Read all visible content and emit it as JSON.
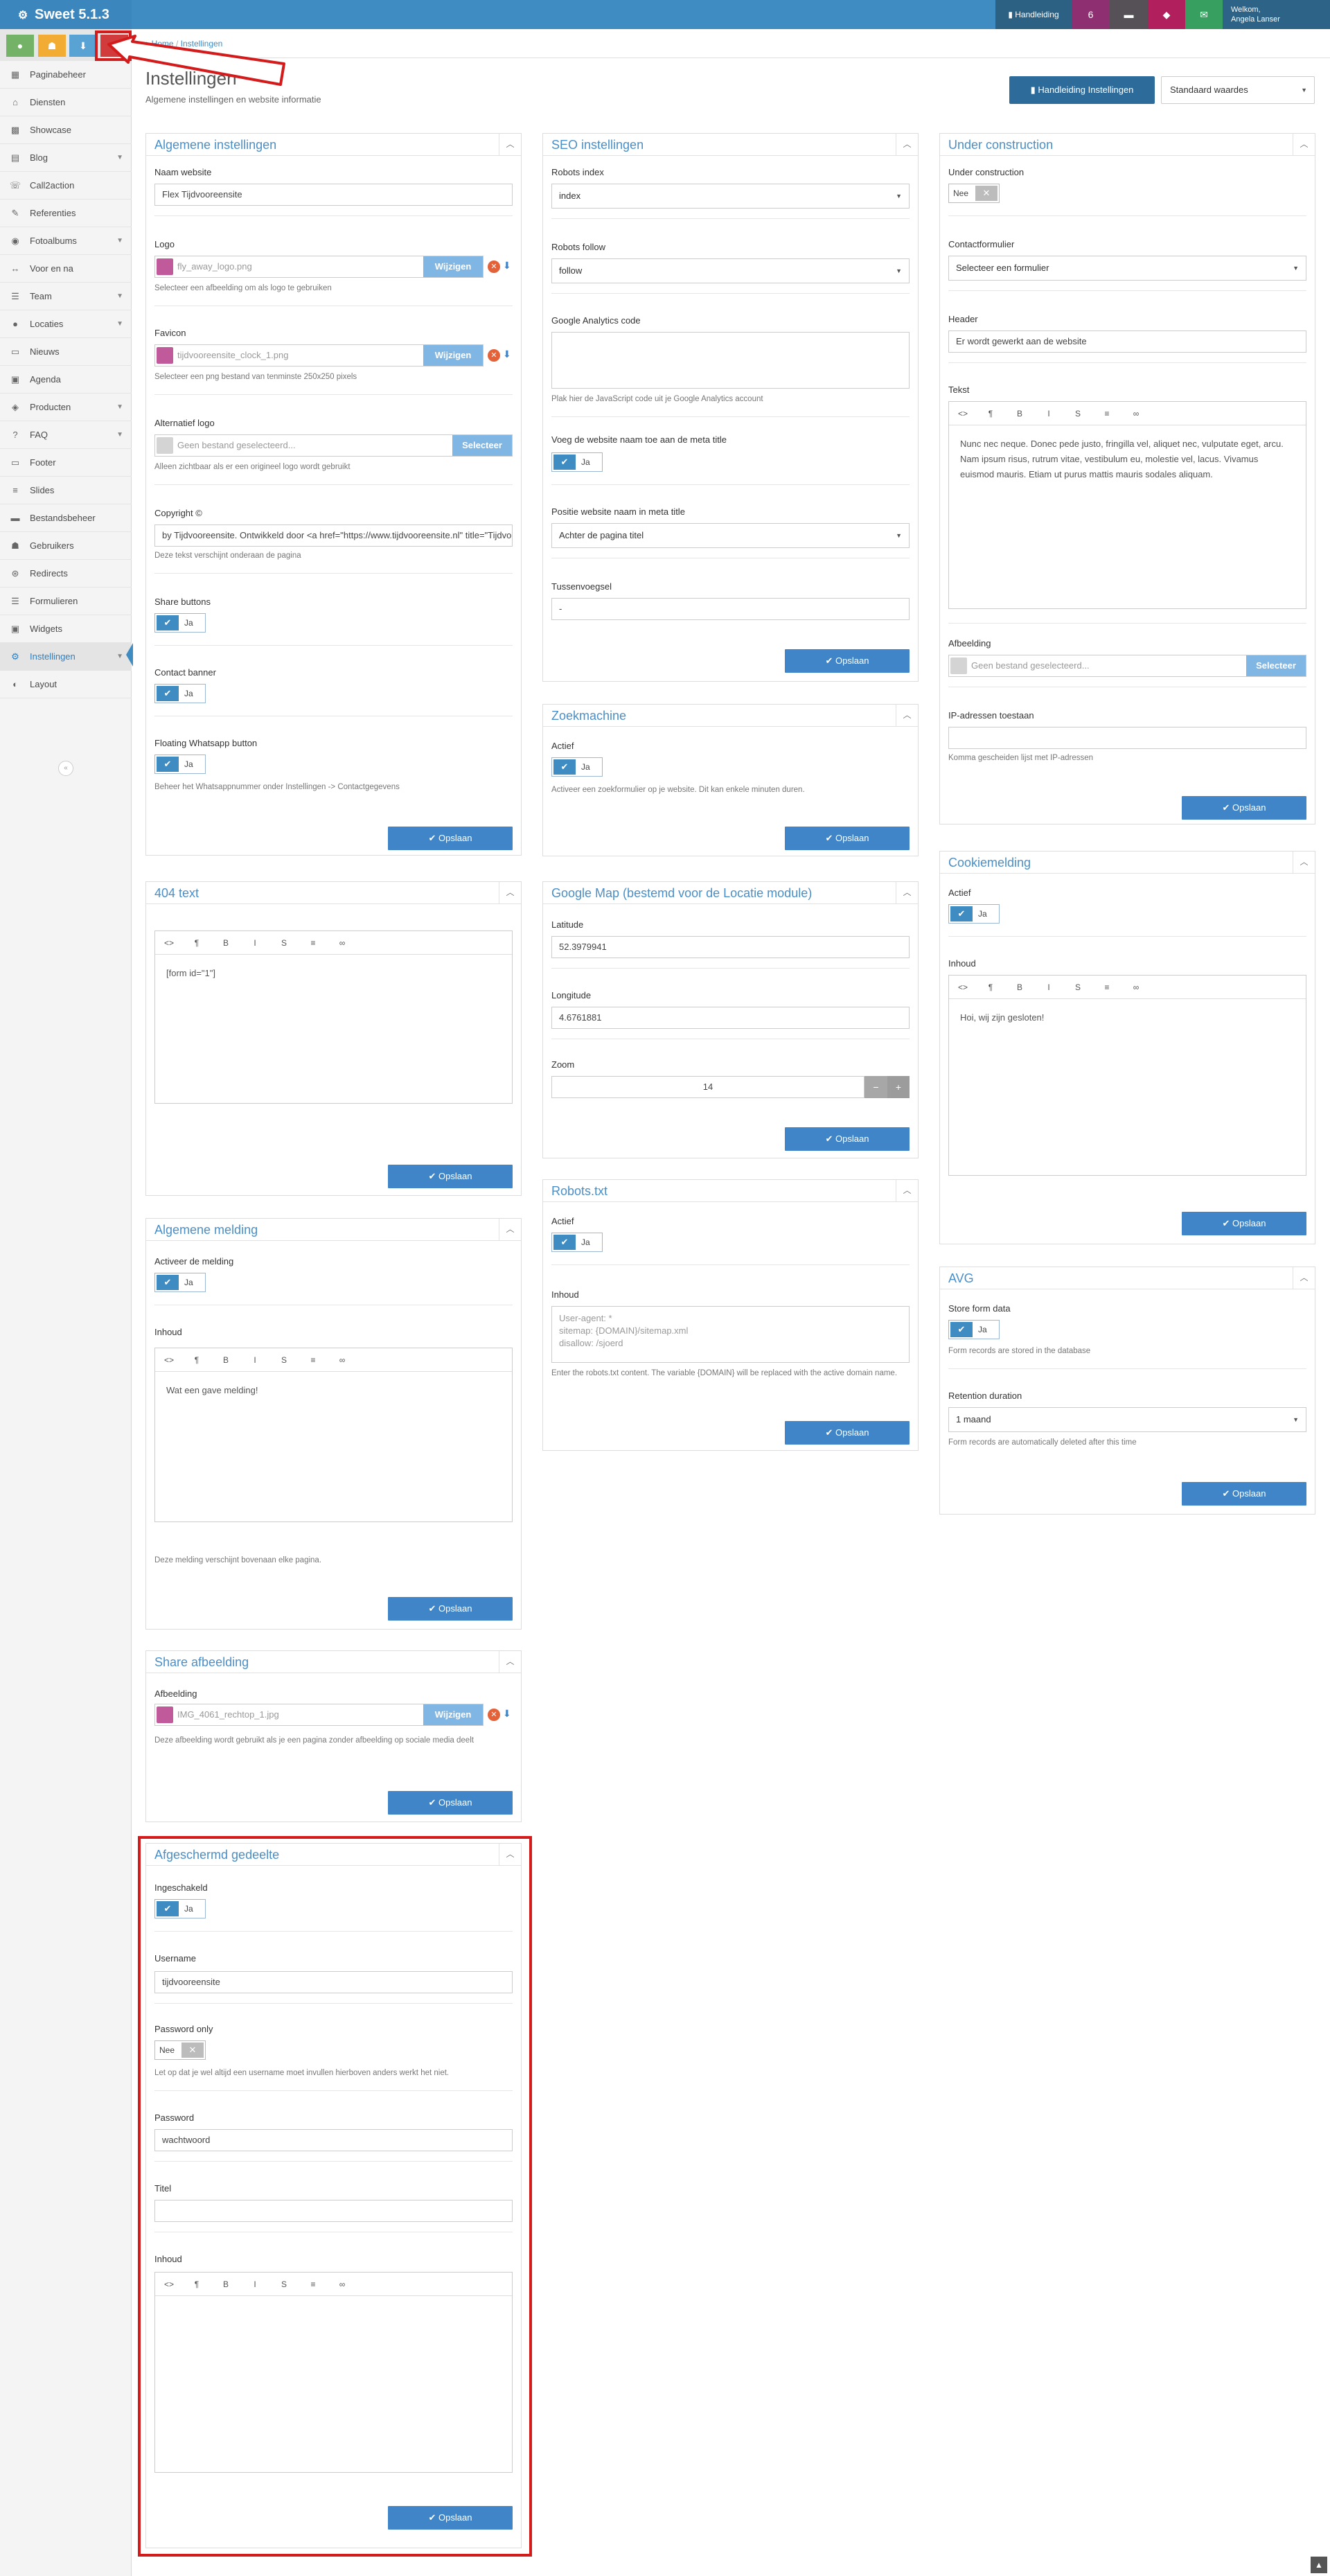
{
  "app": {
    "title": "Sweet 5.1.3"
  },
  "topbar": {
    "manual": "Handleiding",
    "notifications": "6",
    "user_greeting": "Welkom,",
    "user_name": "Angela Lanser"
  },
  "breadcrumb": {
    "home": "Home",
    "separator": "/",
    "current": "Instellingen"
  },
  "page": {
    "title": "Instellingen",
    "subtitle": "Algemene instellingen en website informatie",
    "manual_button": "Handleiding Instellingen",
    "defaults_select": "Standaard waardes"
  },
  "sidebar": {
    "items": [
      {
        "label": "Paginabeheer",
        "icon": "table-icon"
      },
      {
        "label": "Diensten",
        "icon": "tag-icon"
      },
      {
        "label": "Showcase",
        "icon": "grid-icon"
      },
      {
        "label": "Blog",
        "icon": "blog-icon"
      },
      {
        "label": "Call2action",
        "icon": "phone-icon"
      },
      {
        "label": "Referenties",
        "icon": "comments-icon"
      },
      {
        "label": "Fotoalbums",
        "icon": "camera-icon"
      },
      {
        "label": "Voor en na",
        "icon": "arrows-icon"
      },
      {
        "label": "Team",
        "icon": "team-icon"
      },
      {
        "label": "Locaties",
        "icon": "map-marker-icon"
      },
      {
        "label": "Nieuws",
        "icon": "newspaper-icon"
      },
      {
        "label": "Agenda",
        "icon": "calendar-icon"
      },
      {
        "label": "Producten",
        "icon": "tags-icon"
      },
      {
        "label": "FAQ",
        "icon": "question-icon"
      },
      {
        "label": "Footer",
        "icon": "footer-icon"
      },
      {
        "label": "Slides",
        "icon": "sliders-icon"
      },
      {
        "label": "Bestandsbeheer",
        "icon": "folder-icon"
      },
      {
        "label": "Gebruikers",
        "icon": "user-icon"
      },
      {
        "label": "Redirects",
        "icon": "redirect-icon"
      },
      {
        "label": "Formulieren",
        "icon": "form-icon"
      },
      {
        "label": "Widgets",
        "icon": "widget-icon"
      },
      {
        "label": "Instellingen",
        "icon": "gear-icon"
      },
      {
        "label": "Layout",
        "icon": "palette-icon"
      }
    ]
  },
  "common": {
    "save": "✔ Opslaan",
    "yes": "Ja",
    "no": "Nee",
    "change": "Wijzigen",
    "select": "Selecteer"
  },
  "algemeen": {
    "title": "Algemene instellingen",
    "site_name_label": "Naam website",
    "site_name": "Flex Tijdvooreensite",
    "logo_label": "Logo",
    "logo_file": "fly_away_logo.png",
    "logo_help": "Selecteer een afbeelding om als logo te gebruiken",
    "favicon_label": "Favicon",
    "favicon_file": "tijdvooreensite_clock_1.png",
    "favicon_help": "Selecteer een png bestand van tenminste 250x250 pixels",
    "alt_logo_label": "Alternatief logo",
    "alt_logo_placeholder": "Geen bestand geselecteerd...",
    "alt_logo_help": "Alleen zichtbaar als er een origineel logo wordt gebruikt",
    "copyright_label": "Copyright ©",
    "copyright": "by Tijdvooreensite. Ontwikkeld door <a href=\"https://www.tijdvooreensite.nl\" title=\"Tijdvooreensite\">",
    "copyright_help": "Deze tekst verschijnt onderaan de pagina",
    "share_label": "Share buttons",
    "contact_label": "Contact banner",
    "whatsapp_label": "Floating Whatsapp button",
    "whatsapp_help": "Beheer het Whatsappnummer onder Instellingen -> Contactgegevens"
  },
  "seo": {
    "title": "SEO instellingen",
    "index_label": "Robots index",
    "index_value": "index",
    "follow_label": "Robots follow",
    "follow_value": "follow",
    "ga_label": "Google Analytics code",
    "ga_help": "Plak hier de JavaScript code uit je Google Analytics account",
    "meta_label": "Voeg de website naam toe aan de meta title",
    "position_label": "Positie website naam in meta title",
    "position_value": "Achter de pagina titel",
    "sep_label": "Tussenvoegsel",
    "sep_value": "-"
  },
  "construction": {
    "title": "Under construction",
    "uc_label": "Under construction",
    "form_label": "Contactformulier",
    "form_value": "Selecteer een formulier",
    "header_label": "Header",
    "header_value": "Er wordt gewerkt aan de website",
    "text_label": "Tekst",
    "text_value": "Nunc nec neque. Donec pede justo, fringilla vel, aliquet nec, vulputate eget, arcu. Nam ipsum risus, rutrum vitae, vestibulum eu, molestie vel, lacus. Vivamus euismod mauris. Etiam ut purus mattis mauris sodales aliquam.",
    "image_label": "Afbeelding",
    "image_placeholder": "Geen bestand geselecteerd...",
    "ip_label": "IP-adressen toestaan",
    "ip_help": "Komma gescheiden lijst met IP-adressen"
  },
  "search": {
    "title": "Zoekmachine",
    "active_label": "Actief",
    "help": "Activeer een zoekformulier op je website. Dit kan enkele minuten duren."
  },
  "cookie": {
    "title": "Cookiemelding",
    "active_label": "Actief",
    "content_label": "Inhoud",
    "content": "Hoi, wij zijn gesloten!"
  },
  "not_found": {
    "title": "404 text",
    "content": "[form id=\"1\"]"
  },
  "map": {
    "title": "Google Map (bestemd voor de Locatie module)",
    "lat_label": "Latitude",
    "lat": "52.3979941",
    "lng_label": "Longitude",
    "lng": "4.6761881",
    "zoom_label": "Zoom",
    "zoom": "14"
  },
  "avg": {
    "title": "AVG",
    "store_label": "Store form data",
    "store_help": "Form records are stored in the database",
    "retention_label": "Retention duration",
    "retention_value": "1 maand",
    "retention_help": "Form records are automatically deleted after this time"
  },
  "robots": {
    "title": "Robots.txt",
    "active_label": "Actief",
    "content_label": "Inhoud",
    "content": "User-agent: *\nsitemap: {DOMAIN}/sitemap.xml\ndisallow: /sjoerd",
    "help": "Enter the robots.txt content. The variable {DOMAIN} will be replaced with the active domain name."
  },
  "melding": {
    "title": "Algemene melding",
    "active_label": "Activeer de melding",
    "content_label": "Inhoud",
    "content": "Wat een gave melding!",
    "help": "Deze melding verschijnt bovenaan elke pagina."
  },
  "share_image": {
    "title": "Share afbeelding",
    "label": "Afbeelding",
    "file": "IMG_4061_rechtop_1.jpg",
    "help": "Deze afbeelding wordt gebruikt als je een pagina zonder afbeelding op sociale media deelt"
  },
  "protected": {
    "title": "Afgeschermd gedeelte",
    "enabled_label": "Ingeschakeld",
    "username_label": "Username",
    "username": "tijdvooreensite",
    "pwonly_label": "Password only",
    "pwonly_help": "Let op dat je wel altijd een username moet invullen hierboven anders werkt het niet.",
    "password_label": "Password",
    "password": "wachtwoord",
    "title_label": "Titel",
    "content_label": "Inhoud"
  },
  "editor_tools": [
    "<>",
    "¶",
    "B",
    "I",
    "S",
    "≡",
    "∞"
  ]
}
